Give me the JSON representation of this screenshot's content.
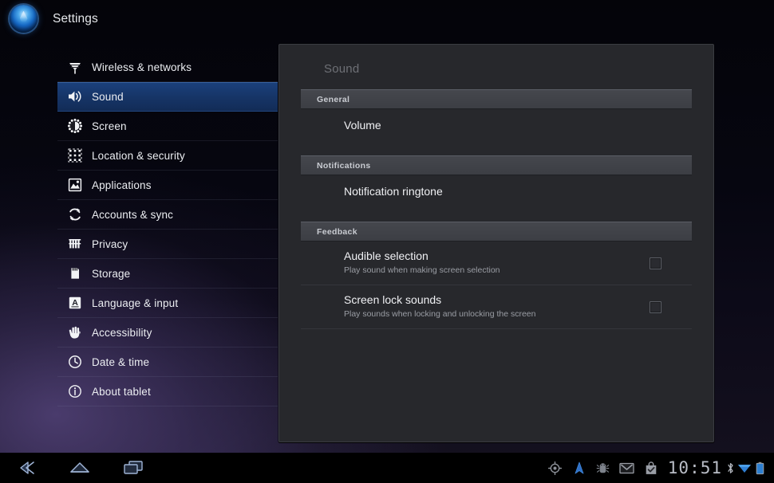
{
  "appbar": {
    "title": "Settings",
    "icon": "settings-orb-icon"
  },
  "sidebar": {
    "items": [
      {
        "label": "Wireless & networks",
        "icon": "wireless-icon",
        "selected": false
      },
      {
        "label": "Sound",
        "icon": "sound-icon",
        "selected": true
      },
      {
        "label": "Screen",
        "icon": "brightness-icon",
        "selected": false
      },
      {
        "label": "Location & security",
        "icon": "location-security-icon",
        "selected": false
      },
      {
        "label": "Applications",
        "icon": "applications-icon",
        "selected": false
      },
      {
        "label": "Accounts & sync",
        "icon": "sync-icon",
        "selected": false
      },
      {
        "label": "Privacy",
        "icon": "privacy-icon",
        "selected": false
      },
      {
        "label": "Storage",
        "icon": "storage-icon",
        "selected": false
      },
      {
        "label": "Language & input",
        "icon": "language-icon",
        "selected": false
      },
      {
        "label": "Accessibility",
        "icon": "accessibility-hand-icon",
        "selected": false
      },
      {
        "label": "Date & time",
        "icon": "clock-icon",
        "selected": false
      },
      {
        "label": "About tablet",
        "icon": "info-icon",
        "selected": false
      }
    ]
  },
  "panel": {
    "title": "Sound",
    "sections": [
      {
        "header": "General",
        "rows": [
          {
            "title": "Volume",
            "subtitle": "",
            "checkbox": false,
            "checked": false
          }
        ]
      },
      {
        "header": "Notifications",
        "rows": [
          {
            "title": "Notification ringtone",
            "subtitle": "",
            "checkbox": false,
            "checked": false
          }
        ]
      },
      {
        "header": "Feedback",
        "rows": [
          {
            "title": "Audible selection",
            "subtitle": "Play sound when making screen selection",
            "checkbox": true,
            "checked": false
          },
          {
            "title": "Screen lock sounds",
            "subtitle": "Play sounds when locking and unlocking the screen",
            "checkbox": true,
            "checked": false
          }
        ]
      }
    ]
  },
  "systembar": {
    "nav": [
      {
        "name": "back-icon"
      },
      {
        "name": "home-icon"
      },
      {
        "name": "recent-apps-icon"
      }
    ],
    "status_icons": [
      {
        "name": "gps-icon"
      },
      {
        "name": "navigation-arrow-icon"
      },
      {
        "name": "android-debug-icon"
      },
      {
        "name": "gmail-icon"
      },
      {
        "name": "market-bag-icon"
      }
    ],
    "clock": "10:51",
    "trailing_icons": [
      {
        "name": "bluetooth-icon"
      },
      {
        "name": "wifi-icon"
      },
      {
        "name": "battery-icon"
      }
    ]
  },
  "colors": {
    "selection_blue": "#17386b",
    "panel_bg": "#27282c",
    "section_header": "#3f4147",
    "accent_blue": "#3d8ad6"
  }
}
